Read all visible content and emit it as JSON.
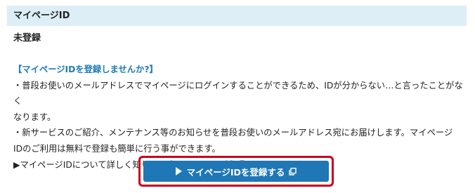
{
  "section": {
    "title": "マイページID"
  },
  "status": {
    "label": "未登録"
  },
  "promo": {
    "heading": "【マイページIDを登録しませんか?】",
    "lines": [
      "・普段お使いのメールアドレスでマイページにログインすることができるため、IDが分からない…と言ったことがなく",
      "なります。",
      "・新サービスのご紹介、メンテナンス等のお知らせを普段お使いのメールアドレス宛にお届けします。マイページ",
      "IDのご利用は無料で登録も簡単に行う事ができます。",
      "▶マイページIDについて詳しく知りたい方はこちらをご参照ください。"
    ]
  },
  "button": {
    "label": "マイページIDを登録する",
    "icons": [
      "play-icon",
      "external-link-icon"
    ],
    "highlight_color": "#c8001e",
    "bg_color": "#1f77b5"
  }
}
